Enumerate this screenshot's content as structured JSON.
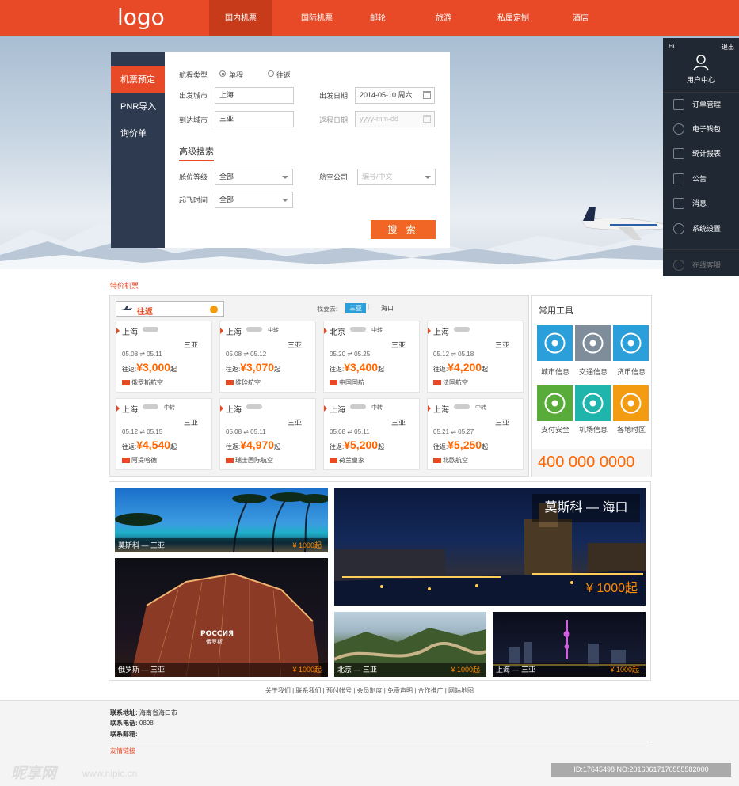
{
  "header": {
    "logo": "logo",
    "nav": [
      "国内机票",
      "国际机票",
      "邮轮",
      "旅游",
      "私属定制",
      "酒店"
    ]
  },
  "search": {
    "tabs": [
      "机票预定",
      "PNR导入",
      "询价单"
    ],
    "trip_type_label": "航程类型",
    "trip_oneway": "单程",
    "trip_round": "往返",
    "from_label": "出发城市",
    "from_value": "上海",
    "to_label": "到达城市",
    "to_value": "三亚",
    "depart_label": "出发日期",
    "depart_value": "2014-05-10  周六",
    "return_label": "返程日期",
    "return_placeholder": "yyyy-mm-dd",
    "advanced_title": "高级搜索",
    "cabin_label": "舱位等级",
    "cabin_value": "全部",
    "airline_label": "航空公司",
    "airline_placeholder": "编号/中文",
    "time_label": "起飞时间",
    "time_value": "全部",
    "search_button": "搜 索"
  },
  "user_center": {
    "hi": "Hi",
    "logout": "退出",
    "title": "用户中心",
    "menu": [
      "订单管理",
      "电子钱包",
      "统计报表",
      "公告",
      "消息",
      "系统设置"
    ],
    "online": "在线客服"
  },
  "deals": {
    "title": "特价机票",
    "round_select": "往返",
    "destination_label": "我要去:",
    "destinations": [
      "三亚",
      "海口"
    ],
    "cards": [
      {
        "from": "上海",
        "transfer": "",
        "to": "三亚",
        "dates": "05.08 ⇌ 05.11",
        "price": "¥3,000",
        "airline": "俄罗斯航空"
      },
      {
        "from": "上海",
        "transfer": "中转",
        "to": "三亚",
        "dates": "05.08 ⇌ 05.12",
        "price": "¥3,070",
        "airline": "维珍航空"
      },
      {
        "from": "北京",
        "transfer": "中转",
        "to": "三亚",
        "dates": "05.20 ⇌ 05.25",
        "price": "¥3,400",
        "airline": "中国国航"
      },
      {
        "from": "上海",
        "transfer": "",
        "to": "三亚",
        "dates": "05.12 ⇌ 05.18",
        "price": "¥4,200",
        "airline": "法国航空"
      },
      {
        "from": "上海",
        "transfer": "中转",
        "to": "三亚",
        "dates": "05.12 ⇌ 05.15",
        "price": "¥4,540",
        "airline": "阿提哈德"
      },
      {
        "from": "上海",
        "transfer": "",
        "to": "三亚",
        "dates": "05.08 ⇌ 05.11",
        "price": "¥4,970",
        "airline": "瑞士国际航空"
      },
      {
        "from": "上海",
        "transfer": "中转",
        "to": "三亚",
        "dates": "05.08 ⇌ 05.11",
        "price": "¥5,200",
        "airline": "荷兰皇家"
      },
      {
        "from": "上海",
        "transfer": "中转",
        "to": "三亚",
        "dates": "05.21 ⇌ 05.27",
        "price": "¥5,250",
        "airline": "北欧航空"
      }
    ],
    "price_prefix": "往返:",
    "price_suffix": "起"
  },
  "tools": {
    "title": "常用工具",
    "items": [
      "城市信息",
      "交通信息",
      "货币信息",
      "支付安全",
      "机场信息",
      "各地时区"
    ],
    "colors": [
      "#2b9fd9",
      "#7f8c99",
      "#2b9fd9",
      "#5aac3a",
      "#1fb5ad",
      "#f39c12"
    ],
    "phone": "400 000 0000"
  },
  "gallery": {
    "items": [
      {
        "title": "莫斯科 — 三亚",
        "price": "¥ 1000起"
      },
      {
        "title": "莫斯科 — 海口",
        "price": "¥ 1000起"
      },
      {
        "title": "俄罗斯 — 三亚",
        "price": "¥ 1000起"
      },
      {
        "title": "北京 — 三亚",
        "price": "¥ 1000起"
      },
      {
        "title": "上海 — 三亚",
        "price": "¥ 1000起"
      }
    ]
  },
  "footer": {
    "links": "关于我们 | 联系我们 | 预付帐号 | 会员制度 | 免责声明 | 合作推广 | 网站地图",
    "address_label": "联系地址:",
    "address": "海南省海口市",
    "phone_label": "联系电话:",
    "phone": "0898-",
    "email_label": "联系邮箱:",
    "friend_links": "友情链接"
  },
  "watermark": {
    "brand": "昵享网",
    "url": "www.nipic.cn",
    "id": "ID:17645498 NO:20160617170555582000"
  }
}
